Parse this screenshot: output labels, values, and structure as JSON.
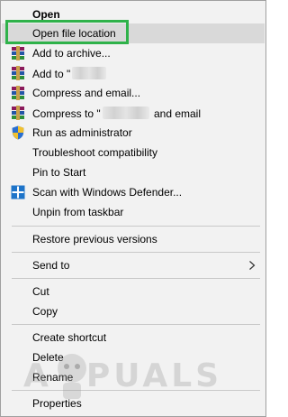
{
  "menu": {
    "open": "Open",
    "open_file_location": "Open file location",
    "add_to_archive": "Add to archive...",
    "add_to_prefix": "Add to \"",
    "compress_and_email": "Compress and email...",
    "compress_to_prefix": "Compress to \"",
    "compress_to_suffix": "and email",
    "run_as_admin": "Run as administrator",
    "troubleshoot": "Troubleshoot compatibility",
    "pin_to_start": "Pin to Start",
    "scan_defender": "Scan with Windows Defender...",
    "unpin_taskbar": "Unpin from taskbar",
    "restore_versions": "Restore previous versions",
    "send_to": "Send to",
    "cut": "Cut",
    "copy": "Copy",
    "create_shortcut": "Create shortcut",
    "delete": "Delete",
    "rename": "Rename",
    "properties": "Properties"
  },
  "icons": {
    "archive": "winrar-archive-icon",
    "shield": "uac-shield-icon",
    "defender": "windows-defender-icon",
    "submenu": "chevron-right-icon"
  },
  "colors": {
    "menu_bg": "#f2f2f2",
    "hover": "#d9d9d9",
    "focus_outline": "#2fb24a"
  },
  "watermark": {
    "text": "A PUALS"
  }
}
